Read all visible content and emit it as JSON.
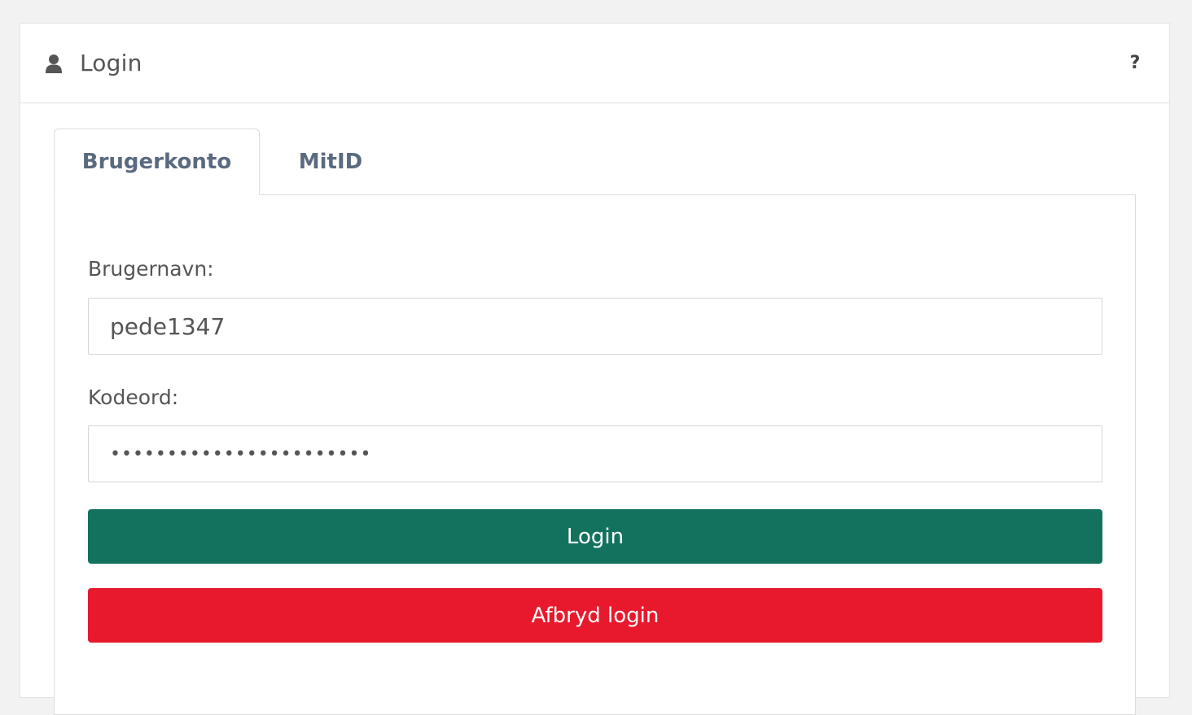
{
  "header": {
    "title": "Login",
    "user_icon": "user-icon",
    "help_label": "?"
  },
  "tabs": [
    {
      "label": "Brugerkonto",
      "active": true
    },
    {
      "label": "MitID",
      "active": false
    }
  ],
  "form": {
    "username_label": "Brugernavn:",
    "username_value": "pede1347",
    "password_label": "Kodeord:",
    "password_value": "xxxxxxxxxxxxxxxxxxxxxxx",
    "login_label": "Login",
    "cancel_label": "Afbryd login"
  },
  "colors": {
    "login_button": "#13725e",
    "cancel_button": "#e8192c",
    "tab_text": "#5a6a80"
  }
}
